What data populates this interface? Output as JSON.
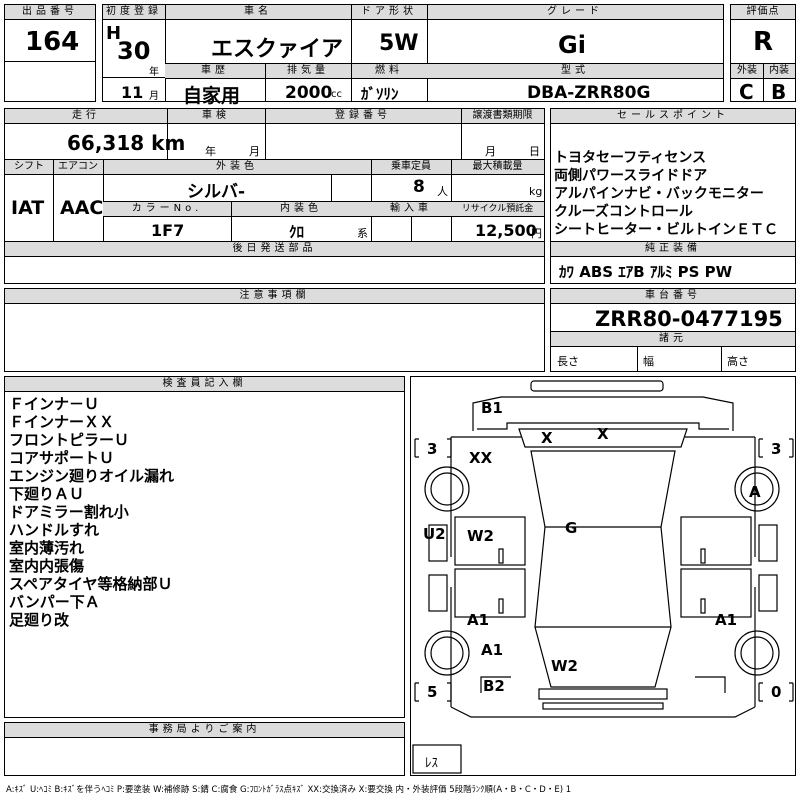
{
  "top": {
    "lot_label": "出品番号",
    "lot_no": "164",
    "first_reg_label": "初度登録",
    "era_letter": "H",
    "year": "30",
    "year_unit": "年",
    "month": "11",
    "month_unit": "月",
    "car_name_label": "車名",
    "car_name": "エスクァイア",
    "history_label": "車歴",
    "history": "自家用",
    "displacement_label": "排気量",
    "displacement": "2000",
    "cc": "cc",
    "door_label": "ドア形状",
    "door": "5W",
    "fuel_label": "燃料",
    "fuel": "ｶﾞｿﾘﾝ",
    "grade_label": "グレード",
    "grade": "Gi",
    "model_label": "型式",
    "model": "DBA-ZRR80G",
    "score_label": "評価点",
    "score": "R",
    "ext_label": "外装",
    "ext": "C",
    "int_label": "内装",
    "int": "B"
  },
  "mid": {
    "mileage_label": "走行",
    "mileage": "66,318 km",
    "inspection_label": "車検",
    "insp_year": "年",
    "insp_month": "月",
    "reg_no_label": "登録番号",
    "transfer_label": "譲渡書類期限",
    "transfer_month": "月",
    "transfer_day": "日",
    "shift_label": "シフト",
    "shift": "IAT",
    "ac_label": "エアコン",
    "ac": "AAC",
    "color_label": "外装色",
    "color": "シルバ-",
    "capacity_label": "乗車定員",
    "capacity": "8",
    "capacity_unit": "人",
    "load_label": "最大積載量",
    "load_unit": "kg",
    "color_no_label": "カラーNo.",
    "color_no": "1F7",
    "int_color_label": "内装色",
    "int_color": "ｸﾛ",
    "int_color_unit": "系",
    "import_label": "輸入車",
    "recycle_label": "リサイクル預託金",
    "recycle": "12,500",
    "recycle_unit": "円",
    "later_parts_label": "後日発送部品"
  },
  "sales_points": {
    "label": "セールスポイント",
    "items": [
      "トヨタセーフティセンス",
      "両側パワースライドドア",
      "アルパインナビ・バックモニター",
      "クルーズコントロール",
      "シートヒーター・ビルトインＥＴＣ"
    ]
  },
  "genuine": {
    "label": "純正装備",
    "value": "ｶﾜ ABS ｴｱB ｱﾙﾐ PS PW"
  },
  "caution_label": "注意事項欄",
  "chassis": {
    "label": "車台番号",
    "value": "ZRR80-0477195"
  },
  "dims": {
    "label": "諸元",
    "length": "長さ",
    "width": "幅",
    "height": "高さ"
  },
  "inspector": {
    "label": "検査員記入欄",
    "notes": [
      "Ｆインナ－Ｕ",
      "ＦインナーＸＸ",
      "フロントピラーＵ",
      "コアサポートＵ",
      "エンジン廻りオイル漏れ",
      "下廻りＡＵ",
      "ドアミラー割れ小",
      "ハンドルすれ",
      "室内薄汚れ",
      "室内内張傷",
      "スペアタイヤ等格納部Ｕ",
      "バンパー下Ａ",
      "足廻り改"
    ]
  },
  "office_label": "事務局よりご案内",
  "diagram": {
    "marks": [
      "B1",
      "X",
      "X",
      "XX",
      "A",
      "G",
      "U2",
      "W2",
      "A1",
      "A1",
      "A1",
      "W2",
      "B2"
    ],
    "tread_fl": "3",
    "tread_fr": "3",
    "tread_rl": "5",
    "tread_rr": "0",
    "spare": "ﾚｽ"
  },
  "legend": "A:ｷｽﾞ U:ﾍｺﾐ B:ｷｽﾞを伴うﾍｺﾐ P:要塗装 W:補修跡 S:錆 C:腐食 G:ﾌﾛﾝﾄｶﾞﾗｽ点ｷｽﾞ XX:交換済み X:要交換 内・外装評価 5段階ﾗﾝｸ順(A・B・C・D・E) 1"
}
